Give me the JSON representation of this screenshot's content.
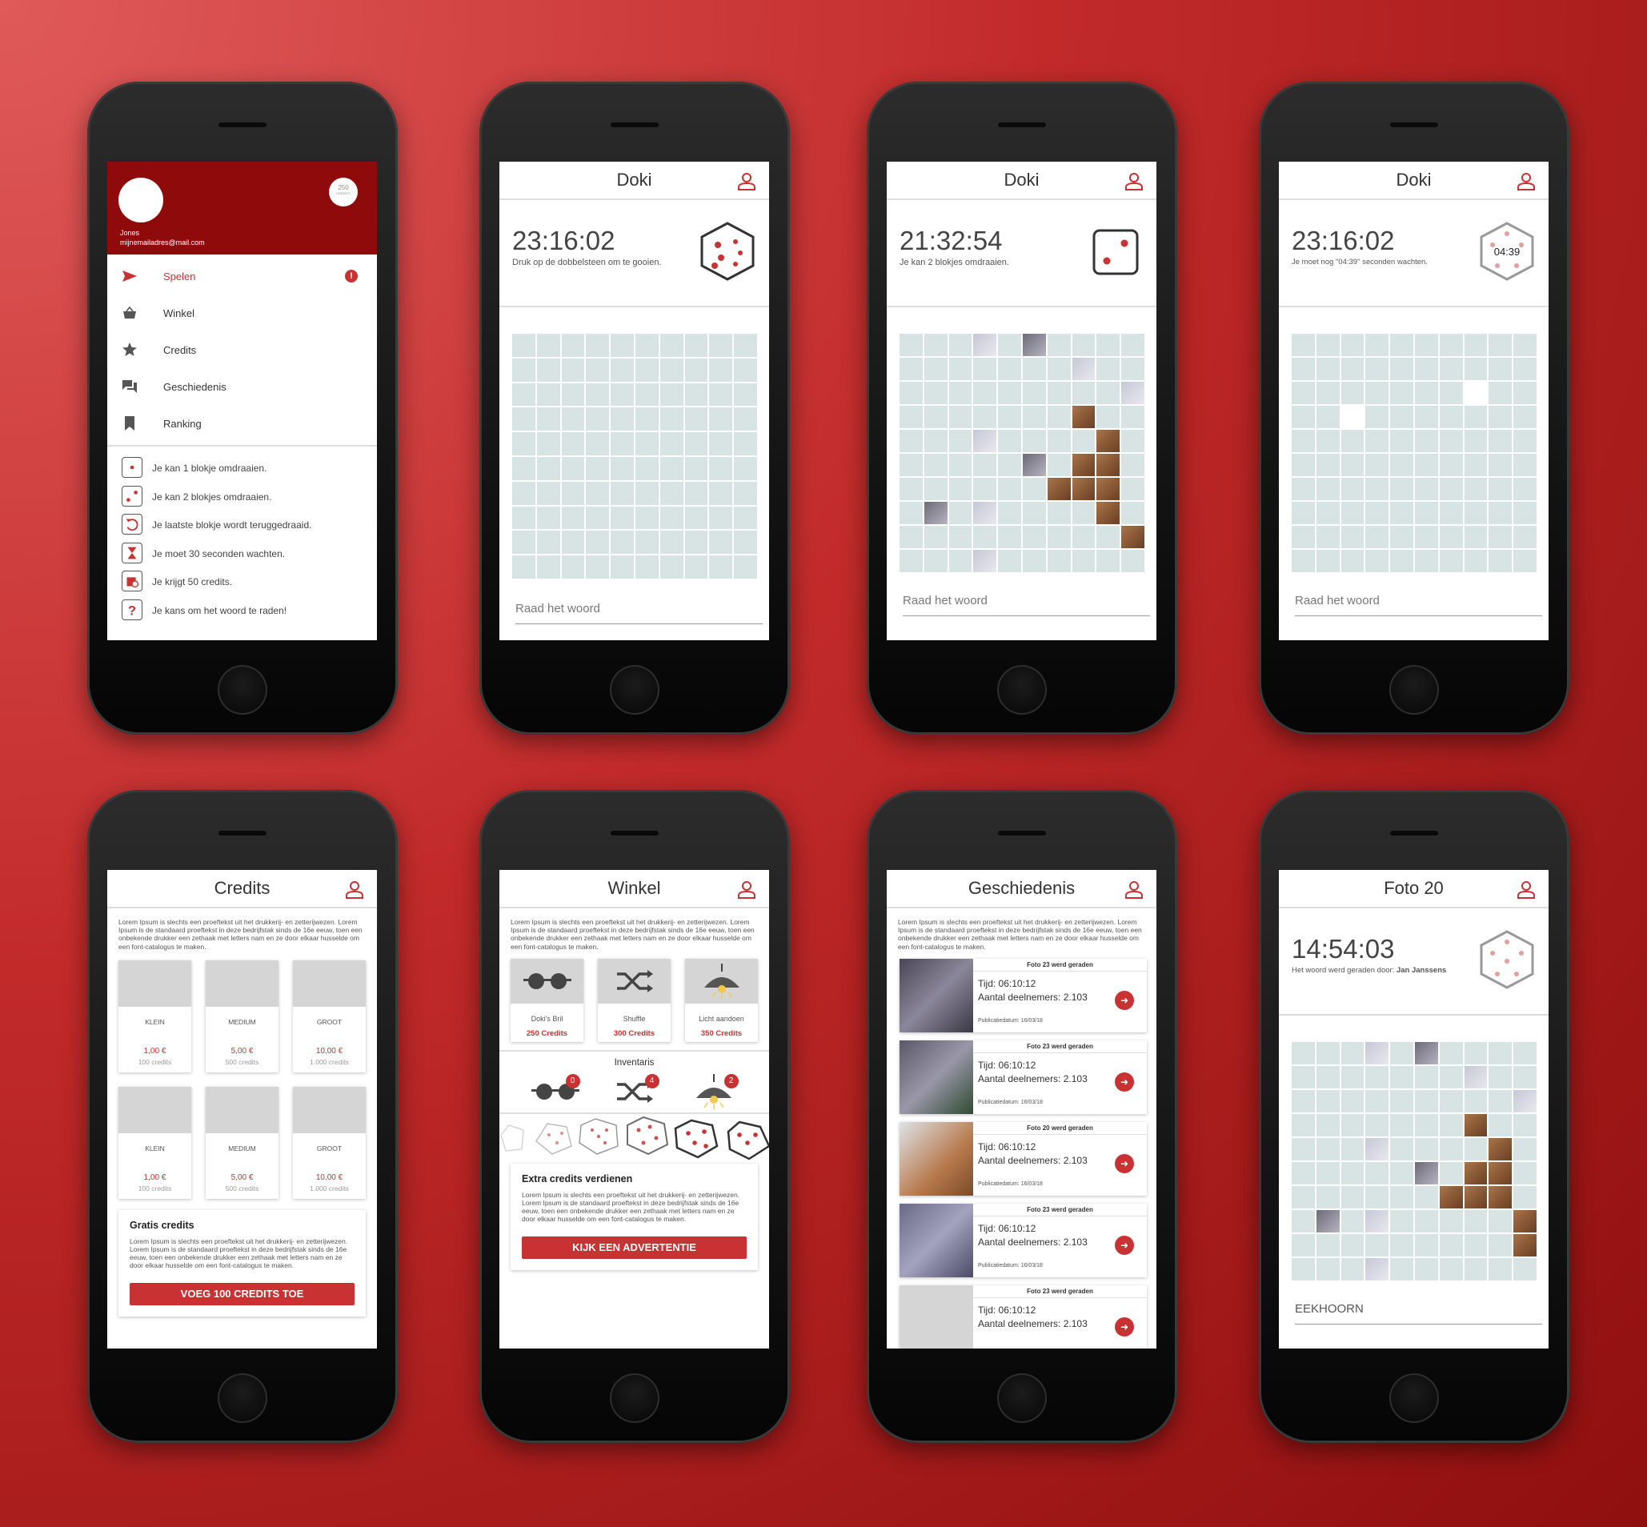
{
  "colors": {
    "accent": "#c83232",
    "drawer": "#8f0b0b",
    "tile": "#d8e3e3"
  },
  "menu": {
    "credits": "250",
    "credits_unit": "CREDITS",
    "user_name": "Jones",
    "user_email": "mijnemailadres@mail.com",
    "alert_mark": "!",
    "items": [
      {
        "label": "Spelen",
        "icon": "send-icon"
      },
      {
        "label": "Winkel",
        "icon": "basket-icon"
      },
      {
        "label": "Credits",
        "icon": "star-icon"
      },
      {
        "label": "Geschiedenis",
        "icon": "chat-icon"
      },
      {
        "label": "Ranking",
        "icon": "bookmark-icon"
      }
    ],
    "legend": [
      "Je kan 1 blokje omdraaien.",
      "Je kan 2 blokjes omdraaien.",
      "Je laatste blokje wordt teruggedraaid.",
      "Je moet 30 seconden wachten.",
      "Je krijgt 50 credits.",
      "Je kans om het woord te raden!"
    ]
  },
  "game1": {
    "title": "Doki",
    "timer": "23:16:02",
    "subtitle": "Druk op de dobbelsteen om te gooien.",
    "guess_placeholder": "Raad het woord"
  },
  "game2": {
    "title": "Doki",
    "timer": "21:32:54",
    "subtitle": "Je kan 2 blokjes omdraaien.",
    "guess_placeholder": "Raad het woord"
  },
  "game3": {
    "title": "Doki",
    "timer": "23:16:02",
    "subtitle": "Je moet nog \"04:39\" seconden wachten.",
    "countdown": "04:39",
    "guess_placeholder": "Raad het woord"
  },
  "credits_screen": {
    "title": "Credits",
    "lorem": "Lorem Ipsum is slechts een proeftekst uit het drukkerij- en zetterijwezen. Lorem Ipsum is de standaard proeftekst in deze bedrijfstak sinds de 16e eeuw, toen een onbekende drukker een zethaak met letters nam en ze door elkaar husselde om een font-catalogus te maken.",
    "packs": [
      {
        "size": "KLEIN",
        "price": "1,00 €",
        "credits": "100 credits"
      },
      {
        "size": "MEDIUM",
        "price": "5,00 €",
        "credits": "500 credits"
      },
      {
        "size": "GROOT",
        "price": "10,00 €",
        "credits": "1.000 credits"
      },
      {
        "size": "KLEIN",
        "price": "1,00 €",
        "credits": "100 credits"
      },
      {
        "size": "MEDIUM",
        "price": "5,00 €",
        "credits": "500 credits"
      },
      {
        "size": "GROOT",
        "price": "10,00 €",
        "credits": "1.000 credits"
      }
    ],
    "free_title": "Gratis credits",
    "free_text": "Lorem Ipsum is slechts een proeftekst uit het drukkerij- en zetterijwezen. Lorem Ipsum is de standaard proeftekst in deze bedrijfstak sinds de 16e eeuw, toen een onbekende drukker een zethaak met letters nam en ze door elkaar husselde om een font-catalogus te maken.",
    "button": "VOEG 100 CREDITS TOE"
  },
  "shop": {
    "title": "Winkel",
    "lorem": "Lorem Ipsum is slechts een proeftekst uit het drukkerij- en zetterijwezen. Lorem Ipsum is de standaard proeftekst in deze bedrijfstak sinds de 16e eeuw, toen een onbekende drukker een zethaak met letters nam en ze door elkaar husselde om een font-catalogus te maken.",
    "items": [
      {
        "name": "Doki's Bril",
        "price": "250 Credits",
        "icon": "glasses-icon"
      },
      {
        "name": "Shuffle",
        "price": "300 Credits",
        "icon": "shuffle-icon"
      },
      {
        "name": "Licht aandoen",
        "price": "350 Credits",
        "icon": "lamp-icon"
      }
    ],
    "inventory_title": "Inventaris",
    "inventory": [
      {
        "icon": "glasses-icon",
        "count": "0"
      },
      {
        "icon": "shuffle-icon",
        "count": "4"
      },
      {
        "icon": "lamp-icon",
        "count": "2"
      }
    ],
    "extra_title": "Extra credits verdienen",
    "extra_text": "Lorem Ipsum is slechts een proeftekst uit het drukkerij- en zetterijwezen. Lorem Ipsum is de standaard proeftekst in deze bedrijfstak sinds de 16e eeuw, toen een onbekende drukker een zethaak met letters nam en ze door elkaar husselde om een font-catalogus te maken.",
    "button": "KIJK EEN ADVERTENTIE"
  },
  "history": {
    "title": "Geschiedenis",
    "lorem": "Lorem Ipsum is slechts een proeftekst uit het drukkerij- en zetterijwezen. Lorem Ipsum is de standaard proeftekst in deze bedrijfstak sinds de 16e eeuw, toen een onbekende drukker een zethaak met letters nam en ze door elkaar husselde om een font-catalogus te maken.",
    "items": [
      {
        "head": "Foto 23 werd geraden",
        "time": "Tijd: 06:10:12",
        "players": "Aantal deelnemers: 2.103",
        "date": "Publicatiedatum: 16/03/18"
      },
      {
        "head": "Foto 23 werd geraden",
        "time": "Tijd: 06:10:12",
        "players": "Aantal deelnemers: 2.103",
        "date": "Publicatiedatum: 16/03/18"
      },
      {
        "head": "Foto 20 werd geraden",
        "time": "Tijd: 06:10:12",
        "players": "Aantal deelnemers: 2.103",
        "date": "Publicatiedatum: 16/03/18"
      },
      {
        "head": "Foto 23 werd geraden",
        "time": "Tijd: 06:10:12",
        "players": "Aantal deelnemers: 2.103",
        "date": "Publicatiedatum: 16/03/18"
      },
      {
        "head": "Foto 23 werd geraden",
        "time": "Tijd: 06:10:12",
        "players": "Aantal deelnemers: 2.103",
        "date": ""
      }
    ]
  },
  "photo": {
    "title": "Foto 20",
    "timer": "14:54:03",
    "subtitle_prefix": "Het woord werd geraden door: ",
    "subtitle_name": "Jan Janssens",
    "answer": "EEKHOORN"
  }
}
